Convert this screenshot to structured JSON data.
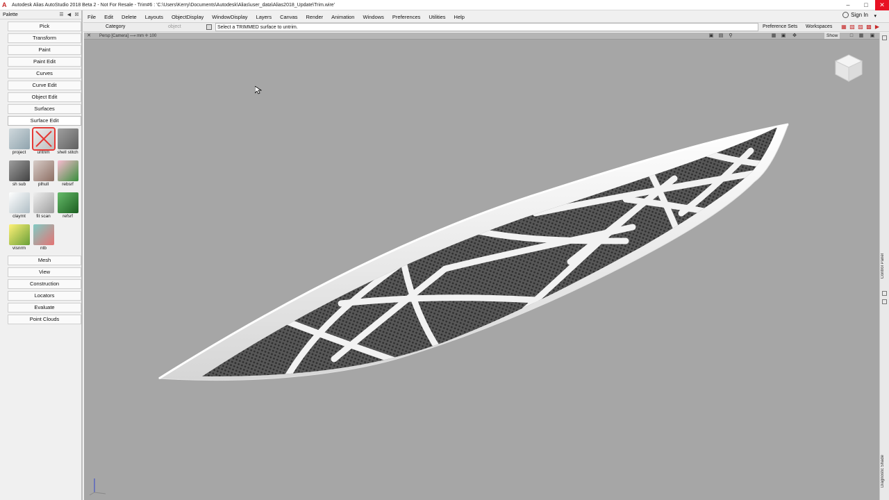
{
  "window": {
    "title": "Autodesk Alias AutoStudio 2018  Beta 2 - Not For Resale   - Trim#6 : 'C:\\Users\\Kerry\\Documents\\Autodesk\\Alias\\user_data\\Alias2018_Update\\Trim.wire'",
    "app_icon": "A"
  },
  "menubar": {
    "items": [
      "File",
      "Edit",
      "Delete",
      "Layouts",
      "ObjectDisplay",
      "WindowDisplay",
      "Layers",
      "Canvas",
      "Render",
      "Animation",
      "Windows",
      "Preferences",
      "Utilities",
      "Help"
    ],
    "sign_in": "Sign In"
  },
  "toolbar": {
    "category_label": "Category",
    "object_label": "object",
    "prompt": "Select a TRIMMED surface to untrim.",
    "preference_sets": "Preference Sets",
    "workspaces": "Workspaces"
  },
  "palette": {
    "header": "Palette",
    "top_tabs": [
      "Pick",
      "Transform",
      "Paint",
      "Paint Edit",
      "Curves",
      "Curve Edit",
      "Object Edit",
      "Surfaces"
    ],
    "active_tab": "Surface Edit",
    "tools": [
      {
        "label": "project",
        "icon": "project-icon",
        "selected": false
      },
      {
        "label": "untrim",
        "icon": "untrim-icon",
        "selected": true
      },
      {
        "label": "shell stitch",
        "icon": "shell-stitch-icon",
        "selected": false
      },
      {
        "label": "sh sub",
        "icon": "shell-subtract-icon",
        "selected": false
      },
      {
        "label": "plhull",
        "icon": "plhull-icon",
        "selected": false
      },
      {
        "label": "rebsrf",
        "icon": "rebuild-surface-icon",
        "selected": false
      },
      {
        "label": "claymt",
        "icon": "clay-mat-icon",
        "selected": false
      },
      {
        "label": "fit scan",
        "icon": "fit-scan-icon",
        "selected": false
      },
      {
        "label": "refsrf",
        "icon": "reference-surface-icon",
        "selected": false
      },
      {
        "label": "visnrm",
        "icon": "visualize-normals-icon",
        "selected": false
      },
      {
        "label": "ntb",
        "icon": "ntb-icon",
        "selected": false
      }
    ],
    "bottom_tabs": [
      "Mesh",
      "View",
      "Construction",
      "Locators",
      "Evaluate",
      "Point Clouds"
    ]
  },
  "viewport": {
    "title": "Persp [Camera]  ⟶ mm  ✛ 100",
    "show_label": "Show",
    "background": "#a6a6a6",
    "viewcube_label": "view-cube"
  },
  "rightrail": {
    "control_panel": "Control Panel",
    "diagnostic_shade": "Diagnostic Shade"
  },
  "colors": {
    "accent_red": "#e53935",
    "mesh_dark": "#3a3a3a",
    "rib_white": "#f4f4f4"
  }
}
